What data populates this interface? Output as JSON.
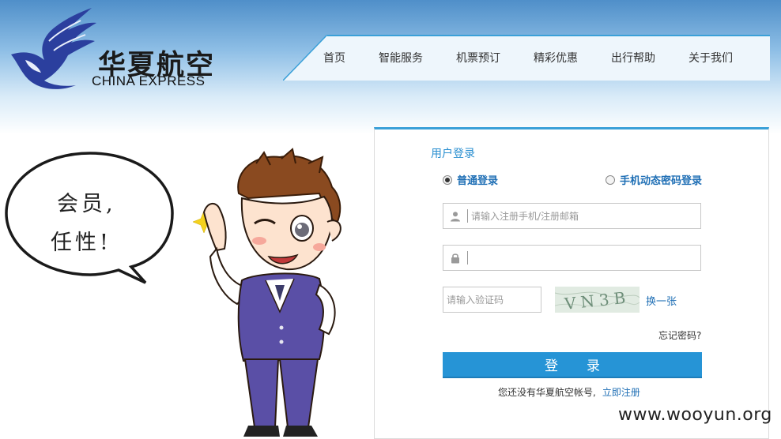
{
  "brand": {
    "name_cn": "华夏航空",
    "name_en": "CHINA EXPRESS"
  },
  "nav": {
    "items": [
      {
        "label": "首页"
      },
      {
        "label": "智能服务"
      },
      {
        "label": "机票预订"
      },
      {
        "label": "精彩优惠"
      },
      {
        "label": "出行帮助"
      },
      {
        "label": "关于我们"
      }
    ]
  },
  "promo": {
    "bubble_line1": "会员,",
    "bubble_line2": "任性!"
  },
  "login": {
    "title": "用户登录",
    "mode_normal": "普通登录",
    "mode_dynamic": "手机动态密码登录",
    "selected_mode": "普通登录",
    "username_placeholder": "请输入注册手机/注册邮箱",
    "username_value": "",
    "password_value": "",
    "captcha_placeholder": "请输入验证码",
    "captcha_text": "VN3B",
    "captcha_refresh": "换一张",
    "forgot_password": "忘记密码?",
    "submit_label": "登录",
    "register_prompt": "您还没有华夏航空帐号,",
    "register_link": "立即注册"
  },
  "watermark": "www.wooyun.org",
  "colors": {
    "accent": "#2694d6",
    "link": "#1f6fb5",
    "logo_blue": "#2b3f9e",
    "header_top": "#4f8fc9"
  },
  "icons": {
    "username": "user-icon",
    "password": "lock-icon",
    "logo": "wing-logo-icon"
  }
}
